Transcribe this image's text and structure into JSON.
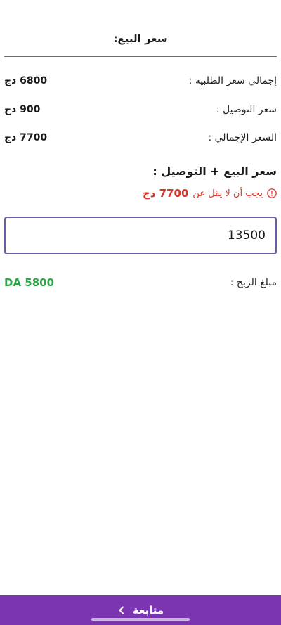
{
  "header": {
    "title": "سعر البيع:"
  },
  "summary": {
    "rows": [
      {
        "label": "إجمالي سعر الطلبية :",
        "value": "6800 دج"
      },
      {
        "label": "سعر التوصيل :",
        "value": "900 دج"
      },
      {
        "label": "السعر الإجمالي :",
        "value": "7700 دج"
      }
    ]
  },
  "sale": {
    "title": "سعر البيع + التوصيل :",
    "error_prefix": "يجب أن لا يقل عن",
    "error_amount": "7700 دج",
    "input_value": "13500"
  },
  "profit": {
    "label": "مبلغ الربح :",
    "value": "DA 5800"
  },
  "footer": {
    "continue_label": "متابعة"
  },
  "colors": {
    "accent": "#7b35b0",
    "input_border": "#6b5ca5",
    "error": "#d9362b",
    "profit": "#29a845"
  }
}
